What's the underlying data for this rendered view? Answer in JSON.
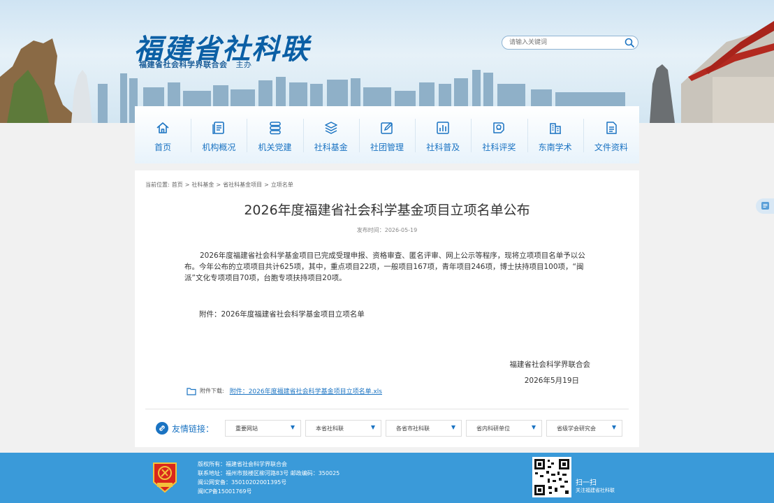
{
  "header": {
    "title": "福建省社科联",
    "subtitle": "福建省社会科学界联合会",
    "subtitle_suffix": "主办",
    "search_placeholder": "请输入关键词"
  },
  "nav": {
    "items": [
      {
        "label": "首页",
        "icon": "home-icon"
      },
      {
        "label": "机构概况",
        "icon": "document-list-icon"
      },
      {
        "label": "机关党建",
        "icon": "stack-icon"
      },
      {
        "label": "社科基金",
        "icon": "layers-icon"
      },
      {
        "label": "社团管理",
        "icon": "edit-icon"
      },
      {
        "label": "社科普及",
        "icon": "chart-icon"
      },
      {
        "label": "社科评奖",
        "icon": "award-icon"
      },
      {
        "label": "东南学术",
        "icon": "building-icon"
      },
      {
        "label": "文件资料",
        "icon": "file-icon"
      }
    ]
  },
  "breadcrumb": {
    "prefix": "当前位置:",
    "items": [
      "首页",
      ">",
      "社科基金",
      ">",
      "省社科基金项目",
      ">",
      "立项名单"
    ]
  },
  "article": {
    "title": "2026年度福建省社会科学基金项目立项名单公布",
    "pubtime": "发布时间：2026-05-19",
    "body": "2026年度福建省社会科学基金项目已完成受理申报、资格审查、匿名评审、网上公示等程序，现将立项项目名单予以公布。今年公布的立项项目共计625项，其中，重点项目22项，一般项目167项，青年项目246项，博士扶持项目100项，“闽派”文化专项项目70项，台胞专项扶持项目20项。",
    "attachment_note": "附件：2026年度福建省社会科学基金项目立项名单",
    "sign_org": "福建省社会科学界联合会",
    "sign_date": "2026年5月19日",
    "download_label": "附件下载:",
    "download_link": "附件：2026年度福建省社会科学基金项目立项名单.xls"
  },
  "friend_links": {
    "label": "友情链接：",
    "selects": [
      "重要网站",
      "本省社科联",
      "各省市社科联",
      "省内科研单位",
      "省级学会研究会"
    ]
  },
  "footer": {
    "lines": [
      "版权所有：福建省社会科学界联合会",
      "联系地址：福州市鼓楼区柳河路83号 邮政编码：350025",
      "闽公网安备：35010202001395号",
      "闽ICP备15001769号"
    ],
    "scan_big": "扫一扫",
    "scan_small": "关注福建省社科联"
  },
  "colors": {
    "accent": "#1a73c2",
    "footer": "#3a9ad9",
    "title": "#0b5fa5"
  }
}
